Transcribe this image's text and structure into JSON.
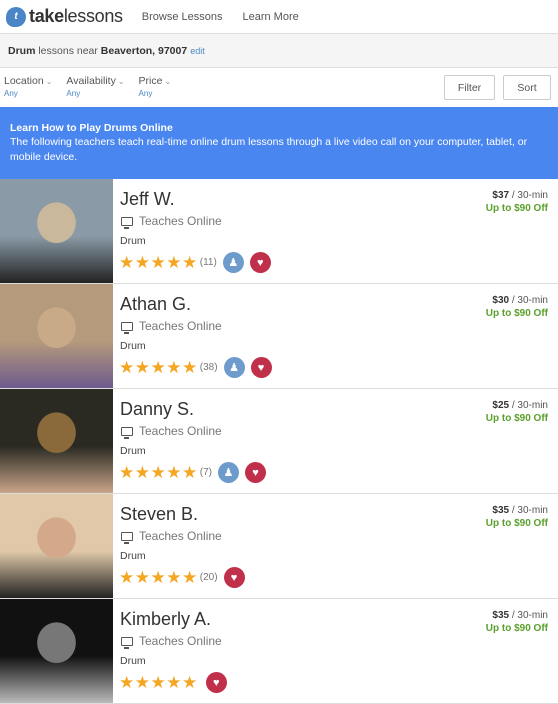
{
  "header": {
    "logo_bold": "take",
    "logo_light": "lessons",
    "nav": [
      "Browse Lessons",
      "Learn More"
    ]
  },
  "search": {
    "instrument": "Drum",
    "middle": " lessons near ",
    "location": "Beaverton, 97007",
    "edit_label": "edit"
  },
  "filters": {
    "items": [
      {
        "label": "Location",
        "value": "Any"
      },
      {
        "label": "Availability",
        "value": "Any"
      },
      {
        "label": "Price",
        "value": "Any"
      }
    ],
    "filter_button": "Filter",
    "sort_button": "Sort"
  },
  "banner": {
    "title": "Learn How to Play Drums Online",
    "description": "The following teachers teach real-time online drum lessons through a live video call on your computer, tablet, or mobile device."
  },
  "teachers": [
    {
      "name": "Jeff W.",
      "online": "Teaches Online",
      "instrument": "Drum",
      "rating": 5,
      "reviews": "(11)",
      "price": "$37",
      "per": " / 30-min",
      "discount": "Up to $90 Off",
      "award": true,
      "photo_colors": [
        "#8a9aa6",
        "#c9b89b",
        "#222"
      ]
    },
    {
      "name": "Athan G.",
      "online": "Teaches Online",
      "instrument": "Drum",
      "rating": 5,
      "reviews": "(38)",
      "price": "$30",
      "per": " / 30-min",
      "discount": "Up to $90 Off",
      "award": true,
      "photo_colors": [
        "#b69a7c",
        "#c8a988",
        "#6c5a8c"
      ]
    },
    {
      "name": "Danny S.",
      "online": "Teaches Online",
      "instrument": "Drum",
      "rating": 5,
      "reviews": "(7)",
      "price": "$25",
      "per": " / 30-min",
      "discount": "Up to $90 Off",
      "award": true,
      "photo_colors": [
        "#2a2a22",
        "#8a6a3a",
        "#c9a58a"
      ]
    },
    {
      "name": "Steven B.",
      "online": "Teaches Online",
      "instrument": "Drum",
      "rating": 5,
      "reviews": "(20)",
      "price": "$35",
      "per": " / 30-min",
      "discount": "Up to $90 Off",
      "award": false,
      "photo_colors": [
        "#e0c8a8",
        "#d4a88a",
        "#222"
      ]
    },
    {
      "name": "Kimberly A.",
      "online": "Teaches Online",
      "instrument": "Drum",
      "rating": 5,
      "reviews": "",
      "price": "$35",
      "per": " / 30-min",
      "discount": "Up to $90 Off",
      "award": false,
      "photo_colors": [
        "#111",
        "#777",
        "#bbb"
      ]
    }
  ]
}
